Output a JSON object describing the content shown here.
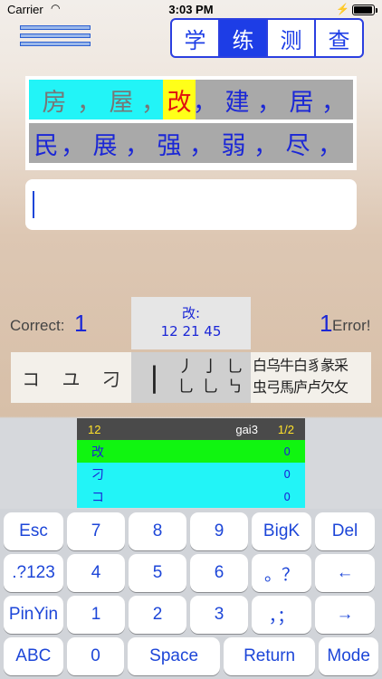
{
  "status": {
    "carrier": "Carrier",
    "time": "3:03 PM",
    "battery_level": 0.95
  },
  "tabs": [
    "学",
    "练",
    "测",
    "查"
  ],
  "active_tab": 1,
  "board": {
    "row1": [
      "房",
      "，",
      "屋",
      "，",
      "改",
      "，",
      "建",
      "，",
      "居",
      "，"
    ],
    "row2": [
      "民",
      "，",
      "展",
      "，",
      "强",
      "，",
      "弱",
      "，",
      "尽",
      "，"
    ]
  },
  "stats": {
    "correct_label": "Correct:",
    "correct_count": "1",
    "error_count": "1",
    "error_label": "Error!",
    "info_char": "改:",
    "info_codes": "12 21 45"
  },
  "strokes": {
    "group1": [
      "コ",
      "ユ",
      "刁"
    ],
    "group2_big": "丨",
    "group2_pairs": [
      [
        "丿",
        "乚"
      ],
      [
        "亅",
        "乚"
      ],
      [
        "乚",
        "㇉"
      ]
    ],
    "group3_line1": "白乌牛白豸彖采",
    "group3_line2": "虫弓馬庐卢欠攵"
  },
  "candidates": {
    "header": {
      "code": "12",
      "pinyin": "gai3",
      "page": "1/2"
    },
    "rows": [
      {
        "word": "改",
        "count": "0",
        "color": "#10f510"
      },
      {
        "word": "刁",
        "count": "0",
        "color": "#22f4f7"
      },
      {
        "word": "コ",
        "count": "0",
        "color": "#22f4f7"
      }
    ]
  },
  "keyboard": {
    "row1": [
      "Esc",
      "7",
      "8",
      "9",
      "BigK",
      "Del"
    ],
    "row2": [
      ".?123",
      "4",
      "5",
      "6",
      "。？",
      "←"
    ],
    "row3": [
      "PinYin",
      "1",
      "2",
      "3",
      "，；",
      "→"
    ],
    "row4": [
      "ABC",
      "0",
      "Space",
      "Return",
      "Mode"
    ]
  },
  "colors": {
    "accent": "#1d3de6",
    "highlight": "#ffff19",
    "done": "#22f4f7"
  }
}
